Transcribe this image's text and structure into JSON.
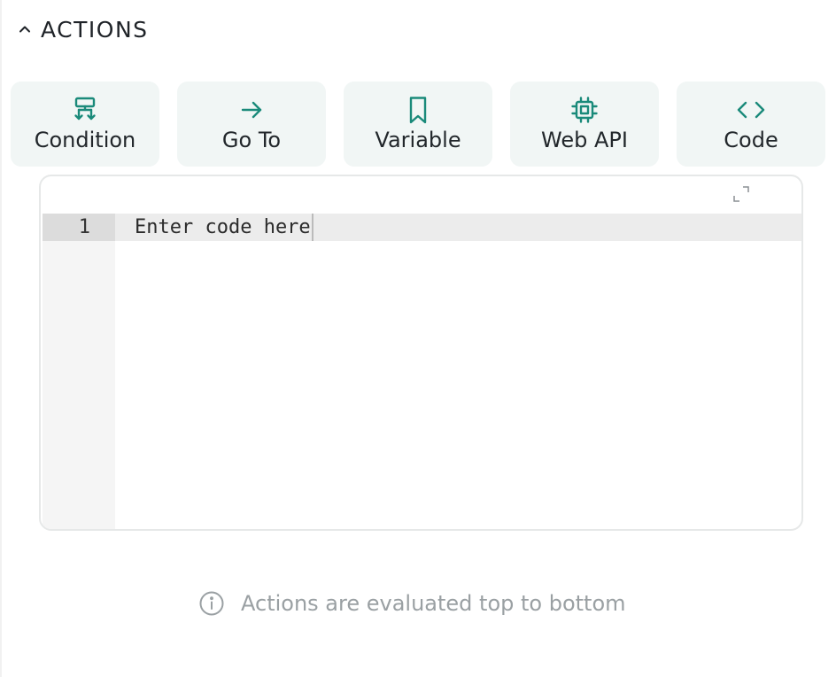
{
  "section": {
    "title": "ACTIONS",
    "icon": "chevron-up-icon"
  },
  "actions": [
    {
      "label": "Condition",
      "icon": "branch-icon"
    },
    {
      "label": "Go To",
      "icon": "arrow-right-icon"
    },
    {
      "label": "Variable",
      "icon": "bookmark-icon"
    },
    {
      "label": "Web API",
      "icon": "chip-icon"
    },
    {
      "label": "Code",
      "icon": "code-brackets-icon"
    }
  ],
  "editor": {
    "line_number": "1",
    "placeholder": "Enter code here",
    "expand_icon": "expand-icon"
  },
  "hint": {
    "text": "Actions are evaluated top to bottom",
    "icon": "info-icon"
  },
  "colors": {
    "accent": "#1a8a7a",
    "button_bg": "#f1f6f5"
  }
}
